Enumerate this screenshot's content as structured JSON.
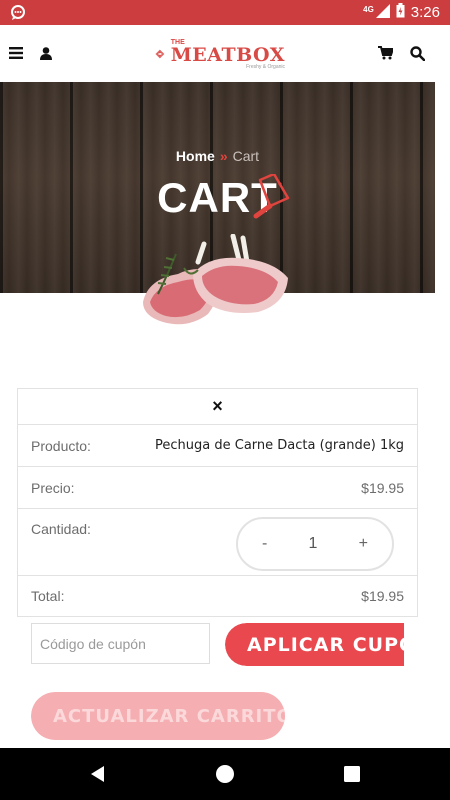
{
  "status_bar": {
    "time": "3:26",
    "network": "4G"
  },
  "brand": {
    "the": "THE",
    "name": "MEATBOX",
    "tagline": "Freshy & Organic"
  },
  "hero": {
    "breadcrumb": {
      "home": "Home",
      "separator": "»",
      "current": "Cart"
    },
    "title": "CART"
  },
  "cart": {
    "remove_symbol": "×",
    "product_label": "Producto:",
    "product_value": "Pechuga de Carne Dacta (grande) 1kg",
    "price_label": "Precio:",
    "price_value": "$19.95",
    "quantity_label": "Cantidad:",
    "quantity": {
      "minus": "-",
      "value": "1",
      "plus": "+"
    },
    "total_label": "Total:",
    "total_value": "$19.95"
  },
  "coupon": {
    "placeholder": "Código de cupón",
    "apply_label": "APLICAR CUPÓN"
  },
  "update_label": "ACTUALIZAR CARRITO",
  "colors": {
    "brand_red": "#cc3d3f",
    "button_red": "#e8484e",
    "button_disabled": "#f5aeb1"
  },
  "icons": {
    "menu": "hamburger-icon",
    "account": "user-icon",
    "cart": "cart-icon",
    "search": "search-icon"
  }
}
